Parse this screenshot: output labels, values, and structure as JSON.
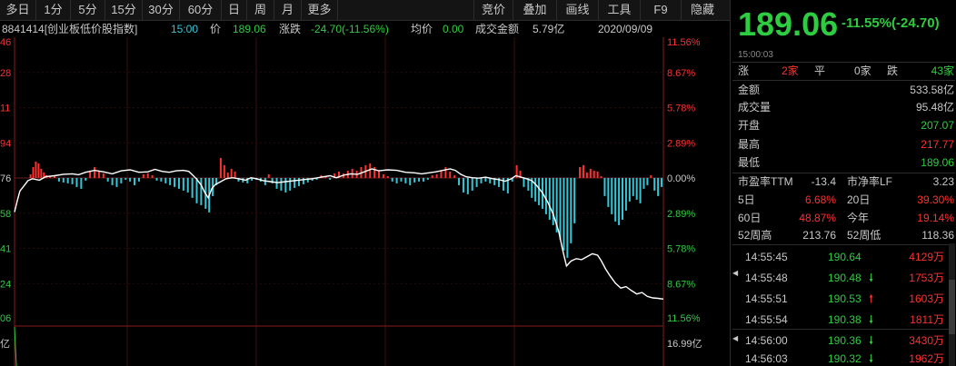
{
  "toolbar": {
    "periods": [
      "多日",
      "1分",
      "5分",
      "15分",
      "30分",
      "60分",
      "日",
      "周",
      "月",
      "更多"
    ],
    "tools": [
      "竞价",
      "叠加",
      "画线",
      "工具",
      "F9",
      "隐藏"
    ]
  },
  "info": {
    "code_name": "8841414[创业板低价股指数]",
    "time": "15:00",
    "price_label": "价",
    "price": "189.06",
    "change_label": "涨跌",
    "change": "-24.70(-11.56%)",
    "avg_label": "均价",
    "avg": "0.00",
    "amount_label": "成交金额",
    "amount": "5.79亿",
    "date": "2020/09/09"
  },
  "chart_data": {
    "type": "line",
    "ylim": [
      185.04,
      242.44
    ],
    "base": 213.76,
    "left_ticks": [
      "46",
      "28",
      "11",
      "94",
      "76",
      "58",
      "41",
      "24",
      "06"
    ],
    "right_ticks": [
      "11.56%",
      "8.67%",
      "5.78%",
      "2.89%",
      "0.00%",
      "2.89%",
      "5.78%",
      "8.67%",
      "11.56%"
    ],
    "volume_label_left": "亿",
    "volume_label_right": "16.99亿",
    "price_series": [
      [
        0,
        206.8
      ],
      [
        3,
        209.0
      ],
      [
        6,
        211.1
      ],
      [
        10,
        212.0
      ],
      [
        15,
        213.2
      ],
      [
        20,
        213.6
      ],
      [
        28,
        213.3
      ],
      [
        35,
        214.0
      ],
      [
        45,
        214.2
      ],
      [
        55,
        214.5
      ],
      [
        65,
        214.6
      ],
      [
        72,
        214.4
      ],
      [
        80,
        214.9
      ],
      [
        90,
        215.3
      ],
      [
        100,
        215.0
      ],
      [
        110,
        214.6
      ],
      [
        120,
        215.2
      ],
      [
        130,
        215.4
      ],
      [
        140,
        214.9
      ],
      [
        150,
        215.0
      ],
      [
        158,
        215.5
      ],
      [
        166,
        215.1
      ],
      [
        174,
        214.9
      ],
      [
        182,
        215.2
      ],
      [
        190,
        215.3
      ],
      [
        196,
        215.1
      ],
      [
        200,
        214.4
      ],
      [
        205,
        213.5
      ],
      [
        210,
        212.3
      ],
      [
        214,
        210.8
      ],
      [
        218,
        209.7
      ],
      [
        222,
        211.6
      ],
      [
        226,
        212.4
      ],
      [
        232,
        213.0
      ],
      [
        238,
        213.6
      ],
      [
        245,
        213.8
      ],
      [
        252,
        213.6
      ],
      [
        260,
        213.3
      ],
      [
        266,
        213.8
      ],
      [
        272,
        213.6
      ],
      [
        280,
        213.2
      ],
      [
        288,
        213.0
      ],
      [
        296,
        212.8
      ],
      [
        305,
        213.0
      ],
      [
        315,
        213.2
      ],
      [
        325,
        213.4
      ],
      [
        335,
        213.6
      ],
      [
        345,
        213.9
      ],
      [
        355,
        214.2
      ],
      [
        362,
        213.8
      ],
      [
        370,
        214.3
      ],
      [
        378,
        214.6
      ],
      [
        386,
        214.5
      ],
      [
        395,
        215.1
      ],
      [
        402,
        215.6
      ],
      [
        410,
        215.2
      ],
      [
        420,
        215.4
      ],
      [
        430,
        215.3
      ],
      [
        440,
        214.9
      ],
      [
        450,
        214.8
      ],
      [
        458,
        214.6
      ],
      [
        466,
        214.8
      ],
      [
        474,
        215.0
      ],
      [
        482,
        215.3
      ],
      [
        490,
        215.6
      ],
      [
        496,
        215.3
      ],
      [
        502,
        214.5
      ],
      [
        508,
        214.0
      ],
      [
        515,
        213.8
      ],
      [
        522,
        213.7
      ],
      [
        530,
        213.9
      ],
      [
        538,
        213.6
      ],
      [
        545,
        213.4
      ],
      [
        552,
        213.1
      ],
      [
        558,
        213.5
      ],
      [
        564,
        214.2
      ],
      [
        570,
        213.9
      ],
      [
        576,
        213.6
      ],
      [
        582,
        213.2
      ],
      [
        588,
        212.1
      ],
      [
        594,
        210.7
      ],
      [
        600,
        208.8
      ],
      [
        606,
        206.4
      ],
      [
        612,
        203.0
      ],
      [
        617,
        198.8
      ],
      [
        621,
        195.8
      ],
      [
        626,
        196.8
      ],
      [
        632,
        197.3
      ],
      [
        638,
        197.1
      ],
      [
        645,
        197.8
      ],
      [
        650,
        198.3
      ],
      [
        656,
        198.0
      ],
      [
        660,
        196.9
      ],
      [
        665,
        195.2
      ],
      [
        670,
        193.8
      ],
      [
        676,
        192.3
      ],
      [
        682,
        191.3
      ],
      [
        688,
        191.6
      ],
      [
        694,
        190.8
      ],
      [
        700,
        190.1
      ],
      [
        706,
        190.4
      ],
      [
        712,
        189.6
      ],
      [
        718,
        189.3
      ],
      [
        724,
        189.2
      ],
      [
        730,
        189.06
      ]
    ],
    "bar_series": [
      [
        18,
        4
      ],
      [
        21,
        12
      ],
      [
        24,
        18
      ],
      [
        27,
        16
      ],
      [
        30,
        10
      ],
      [
        33,
        6
      ],
      [
        36,
        3
      ],
      [
        40,
        2
      ],
      [
        45,
        3
      ],
      [
        50,
        -4
      ],
      [
        55,
        -5
      ],
      [
        60,
        -6
      ],
      [
        65,
        -7
      ],
      [
        70,
        -10
      ],
      [
        75,
        -12
      ],
      [
        80,
        -3
      ],
      [
        85,
        8
      ],
      [
        90,
        12
      ],
      [
        95,
        8
      ],
      [
        100,
        5
      ],
      [
        105,
        -4
      ],
      [
        110,
        -8
      ],
      [
        115,
        -10
      ],
      [
        120,
        -6
      ],
      [
        125,
        -2
      ],
      [
        130,
        -4
      ],
      [
        135,
        -8
      ],
      [
        140,
        -4
      ],
      [
        145,
        4
      ],
      [
        150,
        5
      ],
      [
        155,
        3
      ],
      [
        160,
        -3
      ],
      [
        165,
        -4
      ],
      [
        170,
        -6
      ],
      [
        175,
        -8
      ],
      [
        180,
        -10
      ],
      [
        185,
        -12
      ],
      [
        190,
        -14
      ],
      [
        195,
        -16
      ],
      [
        200,
        -22
      ],
      [
        205,
        -28
      ],
      [
        210,
        -30
      ],
      [
        215,
        -34
      ],
      [
        219,
        -38
      ],
      [
        223,
        -20
      ],
      [
        227,
        -8
      ],
      [
        232,
        22
      ],
      [
        236,
        14
      ],
      [
        240,
        6
      ],
      [
        244,
        10
      ],
      [
        248,
        7
      ],
      [
        252,
        -4
      ],
      [
        257,
        -5
      ],
      [
        262,
        -6
      ],
      [
        267,
        -3
      ],
      [
        272,
        -2
      ],
      [
        277,
        -4
      ],
      [
        282,
        -8
      ],
      [
        286,
        4
      ],
      [
        290,
        -6
      ],
      [
        295,
        -12
      ],
      [
        300,
        -14
      ],
      [
        305,
        -16
      ],
      [
        310,
        -14
      ],
      [
        315,
        -11
      ],
      [
        320,
        -9
      ],
      [
        325,
        -7
      ],
      [
        330,
        -5
      ],
      [
        335,
        -3
      ],
      [
        340,
        -2
      ],
      [
        345,
        3
      ],
      [
        350,
        2
      ],
      [
        355,
        -2
      ],
      [
        360,
        5
      ],
      [
        365,
        7
      ],
      [
        370,
        5
      ],
      [
        375,
        8
      ],
      [
        380,
        10
      ],
      [
        385,
        8
      ],
      [
        390,
        12
      ],
      [
        395,
        14
      ],
      [
        400,
        16
      ],
      [
        405,
        12
      ],
      [
        410,
        8
      ],
      [
        415,
        4
      ],
      [
        420,
        2
      ],
      [
        425,
        -4
      ],
      [
        430,
        -6
      ],
      [
        435,
        -4
      ],
      [
        440,
        -6
      ],
      [
        445,
        -8
      ],
      [
        450,
        -5
      ],
      [
        455,
        -4
      ],
      [
        460,
        -4
      ],
      [
        465,
        -2
      ],
      [
        470,
        3
      ],
      [
        475,
        4
      ],
      [
        480,
        8
      ],
      [
        485,
        12
      ],
      [
        490,
        7
      ],
      [
        495,
        3
      ],
      [
        500,
        -8
      ],
      [
        505,
        -16
      ],
      [
        510,
        -18
      ],
      [
        515,
        -14
      ],
      [
        520,
        -10
      ],
      [
        525,
        -6
      ],
      [
        530,
        -4
      ],
      [
        535,
        -6
      ],
      [
        540,
        -8
      ],
      [
        545,
        -10
      ],
      [
        550,
        -14
      ],
      [
        555,
        -17
      ],
      [
        560,
        -4
      ],
      [
        565,
        14
      ],
      [
        569,
        8
      ],
      [
        573,
        -10
      ],
      [
        578,
        -14
      ],
      [
        582,
        -22
      ],
      [
        586,
        -26
      ],
      [
        590,
        -30
      ],
      [
        594,
        -34
      ],
      [
        598,
        -40
      ],
      [
        602,
        -46
      ],
      [
        606,
        -52
      ],
      [
        610,
        -60
      ],
      [
        614,
        -68
      ],
      [
        618,
        -80
      ],
      [
        622,
        -88
      ],
      [
        626,
        -72
      ],
      [
        630,
        -50
      ],
      [
        636,
        12
      ],
      [
        640,
        14
      ],
      [
        644,
        6
      ],
      [
        648,
        10
      ],
      [
        652,
        8
      ],
      [
        656,
        7
      ],
      [
        660,
        2
      ],
      [
        664,
        -20
      ],
      [
        668,
        -32
      ],
      [
        672,
        -40
      ],
      [
        676,
        -48
      ],
      [
        680,
        -52
      ],
      [
        684,
        -46
      ],
      [
        688,
        -36
      ],
      [
        692,
        -26
      ],
      [
        696,
        -20
      ],
      [
        700,
        -24
      ],
      [
        704,
        -28
      ],
      [
        708,
        -12
      ],
      [
        712,
        -8
      ],
      [
        716,
        3
      ],
      [
        720,
        -14
      ],
      [
        724,
        -20
      ],
      [
        728,
        -10
      ]
    ]
  },
  "quote": {
    "price": "189.06",
    "change": "-11.55%(-24.70)",
    "time": "15:00:03",
    "stats": {
      "up_label": "涨",
      "up_val": "2家",
      "flat_label": "平",
      "flat_val": "0家",
      "down_label": "跌",
      "down_val": "43家"
    },
    "rows": [
      {
        "label": "金额",
        "value": "533.58亿",
        "cls": "white"
      },
      {
        "label": "成交量",
        "value": "95.48亿",
        "cls": "white"
      },
      {
        "label": "开盘",
        "value": "207.07",
        "cls": "green"
      },
      {
        "label": "最高",
        "value": "217.77",
        "cls": "red"
      },
      {
        "label": "最低",
        "value": "189.06",
        "cls": "green"
      }
    ],
    "pe": {
      "l1": "市盈率TTM",
      "v1": "-13.4",
      "l2": "市净率LF",
      "v2": "3.23"
    },
    "ret1": {
      "l1": "5日",
      "v1": "6.68%",
      "l2": "20日",
      "v2": "39.30%"
    },
    "ret2": {
      "l1": "60日",
      "v1": "48.87%",
      "l2": "今年",
      "v2": "19.14%"
    },
    "wk52": {
      "l1": "52周高",
      "v1": "213.76",
      "l2": "52周低",
      "v2": "118.36"
    }
  },
  "ticks": [
    {
      "time": "14:55:45",
      "price": "190.64",
      "dir": "",
      "vol": "4129万"
    },
    {
      "time": "14:55:48",
      "price": "190.48",
      "dir": "down",
      "vol": "1753万"
    },
    {
      "time": "14:55:51",
      "price": "190.53",
      "dir": "up",
      "vol": "1603万"
    },
    {
      "time": "14:55:54",
      "price": "190.38",
      "dir": "down",
      "vol": "1811万"
    },
    {
      "time": "14:56:00",
      "price": "190.36",
      "dir": "down",
      "vol": "3430万"
    },
    {
      "time": "14:56:03",
      "price": "190.32",
      "dir": "down",
      "vol": "1962万"
    }
  ],
  "colors": {
    "up": "#ff3030",
    "down": "#2ecc40",
    "bar_down": "#33c8d8",
    "line": "#ffffff"
  }
}
